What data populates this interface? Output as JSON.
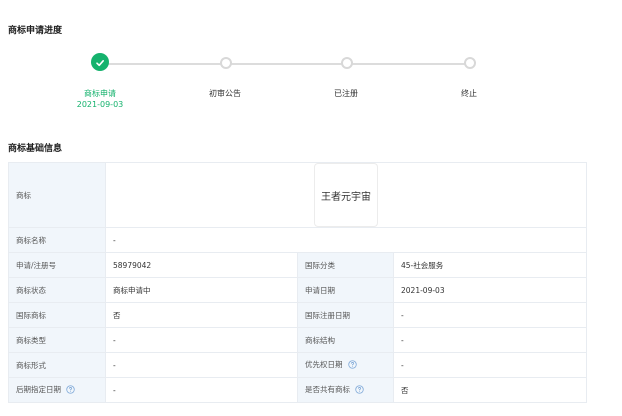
{
  "progress": {
    "title": "商标申请进度",
    "steps": [
      {
        "label": "商标申请",
        "date": "2021-09-03",
        "status": "done"
      },
      {
        "label": "初审公告",
        "status": "pending"
      },
      {
        "label": "已注册",
        "status": "pending"
      },
      {
        "label": "终止",
        "status": "pending"
      }
    ]
  },
  "basic_info": {
    "title": "商标基础信息",
    "trademark_label": "商标",
    "trademark_text": "王者元宇宙",
    "name_label": "商标名称",
    "name_value": "-",
    "rows": [
      {
        "l1": "申请/注册号",
        "v1": "58979042",
        "l2": "国际分类",
        "v2": "45-社会服务"
      },
      {
        "l1": "商标状态",
        "v1": "商标申请中",
        "l2": "申请日期",
        "v2": "2021-09-03"
      },
      {
        "l1": "国际商标",
        "v1": "否",
        "l2": "国际注册日期",
        "v2": "-"
      },
      {
        "l1": "商标类型",
        "v1": "-",
        "l2": "商标结构",
        "v2": "-"
      },
      {
        "l1": "商标形式",
        "v1": "-",
        "l2": "优先权日期",
        "v2": "-"
      },
      {
        "l1": "后期指定日期",
        "v1": "-",
        "l2": "是否共有商标",
        "v2": "否"
      }
    ]
  },
  "colors": {
    "accent": "#15b26d",
    "label_bg": "#f1f6fb",
    "border": "#e8ecf1"
  },
  "icons": {
    "done": "check-icon",
    "help": "question-circle-icon"
  }
}
